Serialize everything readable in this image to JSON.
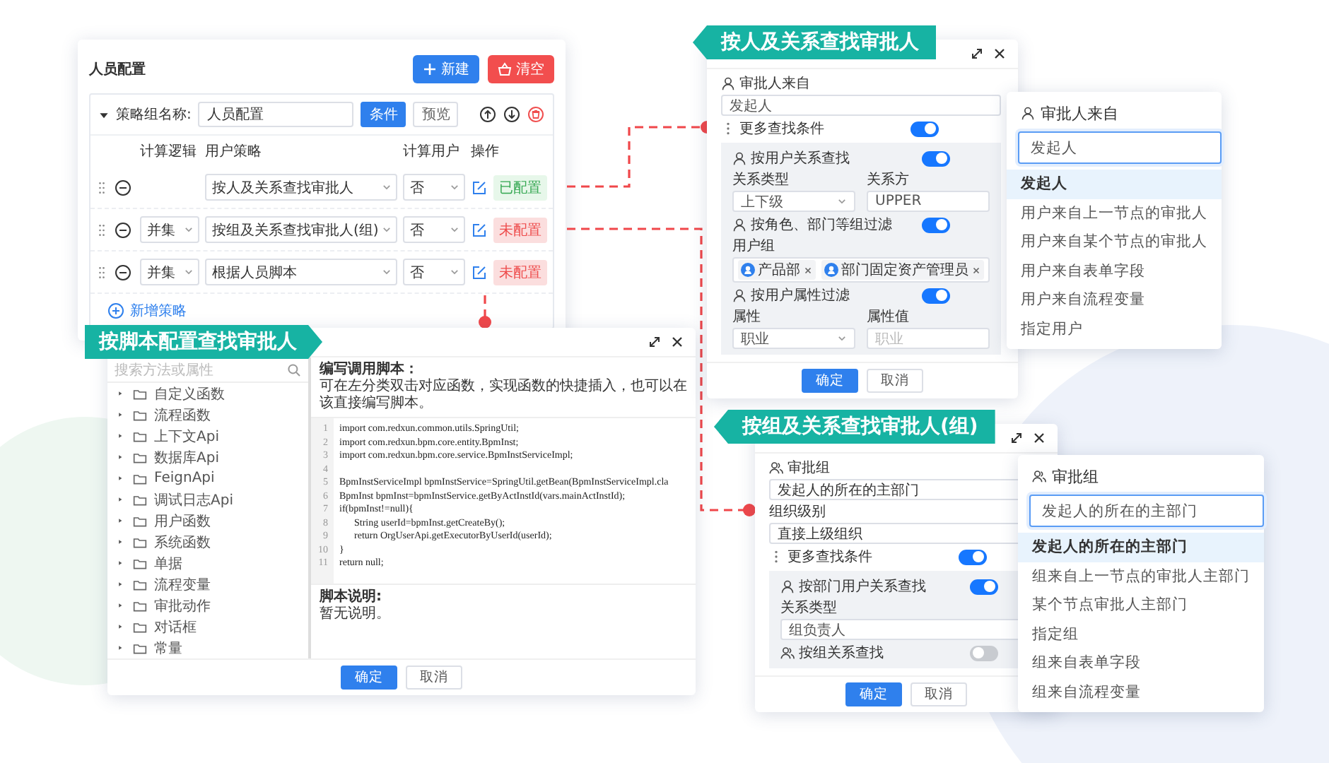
{
  "person_config": {
    "title": "人员配置",
    "buttons": [
      {
        "label": "新建",
        "kind": "primary"
      },
      {
        "label": "清空",
        "kind": "danger"
      }
    ],
    "group": {
      "expanded": true,
      "name_label": "策略组名称:",
      "name_value": "人员配置",
      "tabs": [
        {
          "label": "条件",
          "selected": true
        },
        {
          "label": "预览",
          "selected": false
        }
      ],
      "columns": [
        "计算逻辑",
        "用户策略",
        "计算用户",
        "操作"
      ],
      "rows": [
        {
          "strategy": "按人及关系查找审批人",
          "compute": "否",
          "status": "已配置",
          "configured": true
        },
        {
          "logic": "并集",
          "strategy": "按组及关系查找审批人(组)",
          "compute": "否",
          "status": "未配置",
          "configured": false
        },
        {
          "logic": "并集",
          "strategy": "根据人员脚本",
          "compute": "否",
          "status": "未配置",
          "configured": false
        }
      ],
      "add_label": "新增策略"
    }
  },
  "script_dialog": {
    "tag": "按脚本配置查找审批人",
    "search_placeholder": "搜索方法或属性",
    "tree": [
      {
        "label": "自定义函数",
        "expanded": false
      },
      {
        "label": "流程函数",
        "expanded": false
      },
      {
        "label": "上下文Api",
        "expanded": false
      },
      {
        "label": "数据库Api",
        "expanded": false
      },
      {
        "label": "FeignApi",
        "expanded": false
      },
      {
        "label": "调试日志Api",
        "expanded": false
      },
      {
        "label": "用户函数",
        "expanded": false
      },
      {
        "label": "系统函数",
        "expanded": false
      },
      {
        "label": "单据",
        "expanded": false
      },
      {
        "label": "流程变量",
        "expanded": false
      },
      {
        "label": "审批动作",
        "expanded": false
      },
      {
        "label": "对话框",
        "expanded": false
      },
      {
        "label": "常量",
        "expanded": false
      }
    ],
    "heading": "编写调用脚本：",
    "hint": "可在左分类双击对应函数，实现函数的快捷插入，也可以在该直接编写脚本。",
    "code_lines": [
      {
        "no": "1",
        "text": "import com.redxun.common.utils.SpringUtil;"
      },
      {
        "no": "2",
        "text": "import com.redxun.bpm.core.entity.BpmInst;"
      },
      {
        "no": "3",
        "text": "import com.redxun.bpm.core.service.BpmInstServiceImpl;"
      },
      {
        "no": "4"
      },
      {
        "no": "5",
        "text": "BpmInstServiceImpl bpmInstService=SpringUtil.getBean(BpmInstServiceImpl.cla"
      },
      {
        "no": "6",
        "text": "BpmInst bpmInst=bpmInstService.getByActInstId(vars.mainActInstId);"
      },
      {
        "no": "7",
        "text": "if(bpmInst!=null){"
      },
      {
        "no": "8",
        "text": "      String userId=bpmInst.getCreateBy();"
      },
      {
        "no": "9",
        "text": "      return OrgUserApi.getExecutorByUserId(userId);"
      },
      {
        "no": "10",
        "text": "}"
      },
      {
        "no": "11",
        "text": "return null;"
      }
    ],
    "note_heading": "脚本说明:",
    "note": "暂无说明。",
    "buttons": [
      {
        "label": "确定",
        "kind": "primary"
      },
      {
        "label": "取消",
        "kind": "default"
      }
    ]
  },
  "person_dialog": {
    "tag": "按人及关系查找审批人",
    "source_label": "审批人来自",
    "source_value": "发起人",
    "more_label": "更多查找条件",
    "more_on": true,
    "relation": {
      "label": "按用户关系查找",
      "on": true,
      "fields": [
        {
          "label": "关系类型",
          "value": "上下级",
          "kind": "select"
        },
        {
          "label": "关系方",
          "value": "UPPER",
          "kind": "input"
        }
      ]
    },
    "role_filter": {
      "label": "按角色、部门等组过滤",
      "on": true,
      "group_label": "用户组",
      "tags": [
        "产品部",
        "部门固定资产管理员"
      ]
    },
    "attr_filter": {
      "label": "按用户属性过滤",
      "on": true,
      "fields": [
        {
          "label": "属性",
          "value": "职业",
          "kind": "select"
        },
        {
          "label": "属性值",
          "placeholder": "职业",
          "kind": "input"
        }
      ]
    },
    "buttons": [
      {
        "label": "确定",
        "kind": "primary"
      },
      {
        "label": "取消",
        "kind": "default"
      }
    ]
  },
  "person_dropdown": {
    "title": "审批人来自",
    "value": "发起人",
    "options": [
      {
        "label": "发起人",
        "selected": true
      },
      {
        "label": "用户来自上一节点的审批人",
        "selected": false
      },
      {
        "label": "用户来自某个节点的审批人",
        "selected": false
      },
      {
        "label": "用户来自表单字段",
        "selected": false
      },
      {
        "label": "用户来自流程变量",
        "selected": false
      },
      {
        "label": "指定用户",
        "selected": false
      }
    ]
  },
  "group_dialog": {
    "tag": "按组及关系查找审批人(组)",
    "group_label": "审批组",
    "group_value": "发起人的所在的主部门",
    "level_label": "组织级别",
    "level_value": "直接上级组织",
    "more_label": "更多查找条件",
    "more_on": true,
    "dept_relation": {
      "label": "按部门用户关系查找",
      "on": true,
      "field_label": "关系类型",
      "field_value": "组负责人"
    },
    "group_relation": {
      "label": "按组关系查找",
      "on": false
    },
    "buttons": [
      {
        "label": "确定",
        "kind": "primary"
      },
      {
        "label": "取消",
        "kind": "default"
      }
    ]
  },
  "group_dropdown": {
    "title": "审批组",
    "value": "发起人的所在的主部门",
    "options": [
      {
        "label": "发起人的所在的主部门",
        "selected": true
      },
      {
        "label": "组来自上一节点的审批人主部门",
        "selected": false
      },
      {
        "label": "某个节点审批人主部门",
        "selected": false
      },
      {
        "label": "指定组",
        "selected": false
      },
      {
        "label": "组来自表单字段",
        "selected": false
      },
      {
        "label": "组来自流程变量",
        "selected": false
      }
    ]
  }
}
